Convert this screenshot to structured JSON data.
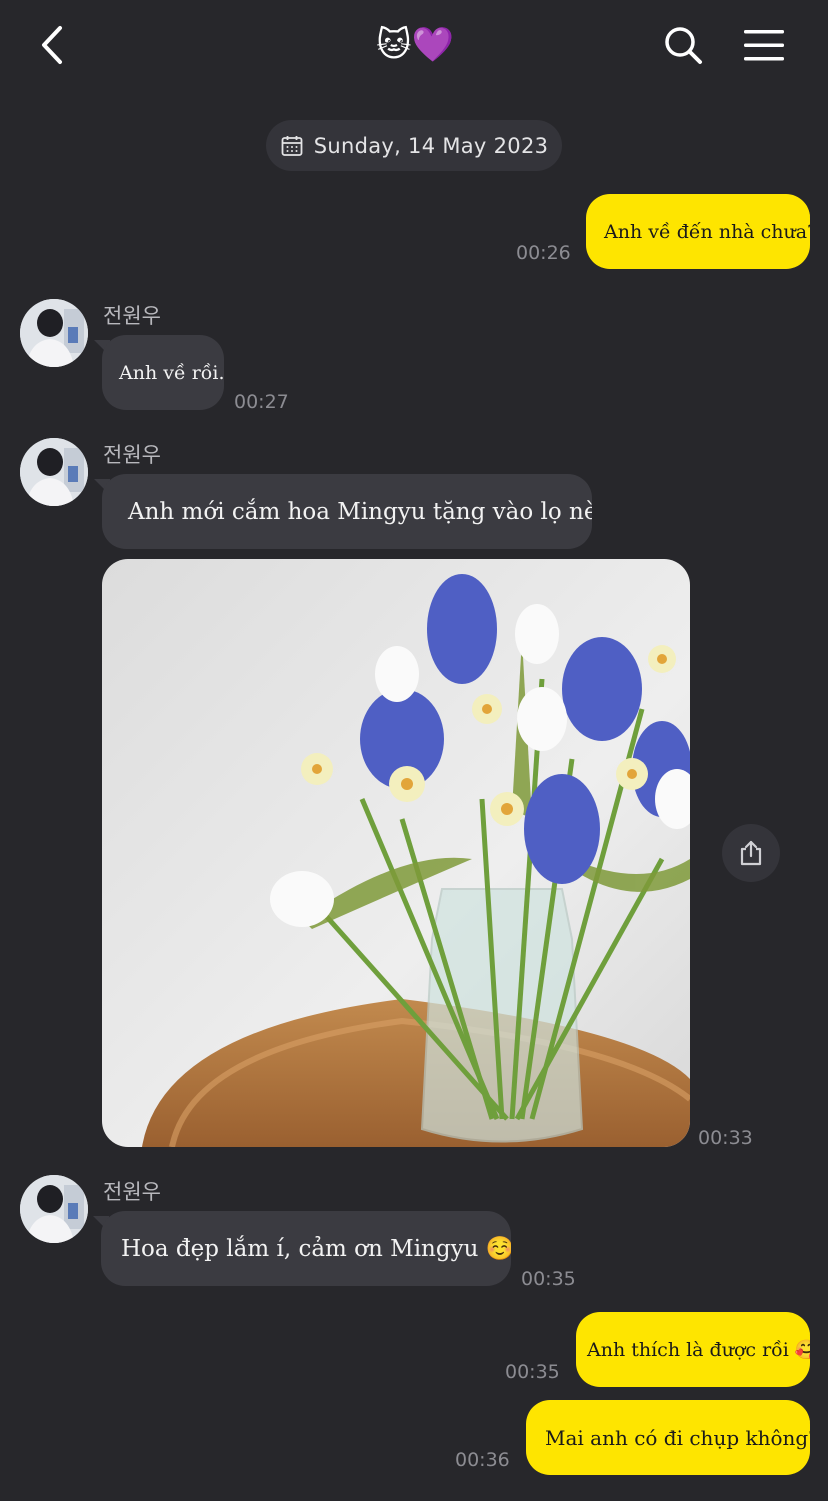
{
  "header": {
    "title": "🐱💜",
    "back_icon": "chevron-left-icon",
    "search_icon": "search-icon",
    "menu_icon": "hamburger-menu-icon"
  },
  "date_divider": {
    "text": "Sunday, 14 May 2023",
    "icon": "calendar-icon"
  },
  "messages": [
    {
      "side": "me",
      "text": "Anh về đến nhà chưa?",
      "time": "00:26"
    },
    {
      "side": "them",
      "sender": "전원우",
      "text": "Anh về rồi.",
      "time": "00:27"
    },
    {
      "side": "them",
      "sender": "전원우",
      "text": "Anh mới cắm hoa Mingyu tặng vào lọ nè."
    },
    {
      "side": "them",
      "type": "image",
      "alt": "Blue hyacinths, white tulips and daffodils in a glass jar on a rattan tray",
      "time": "00:33"
    },
    {
      "side": "them",
      "sender": "전원우",
      "text": "Hoa đẹp lắm í, cảm ơn Mingyu ☺️",
      "time": "00:35"
    },
    {
      "side": "me",
      "text": "Anh thích là được rồi 🥰",
      "time": "00:35"
    },
    {
      "side": "me",
      "text": "Mai anh có đi chụp không?",
      "time": "00:36"
    }
  ],
  "colors": {
    "background": "#27272b",
    "my_bubble": "#fee500",
    "their_bubble": "#3b3b41",
    "timestamp": "#8c8c92"
  }
}
